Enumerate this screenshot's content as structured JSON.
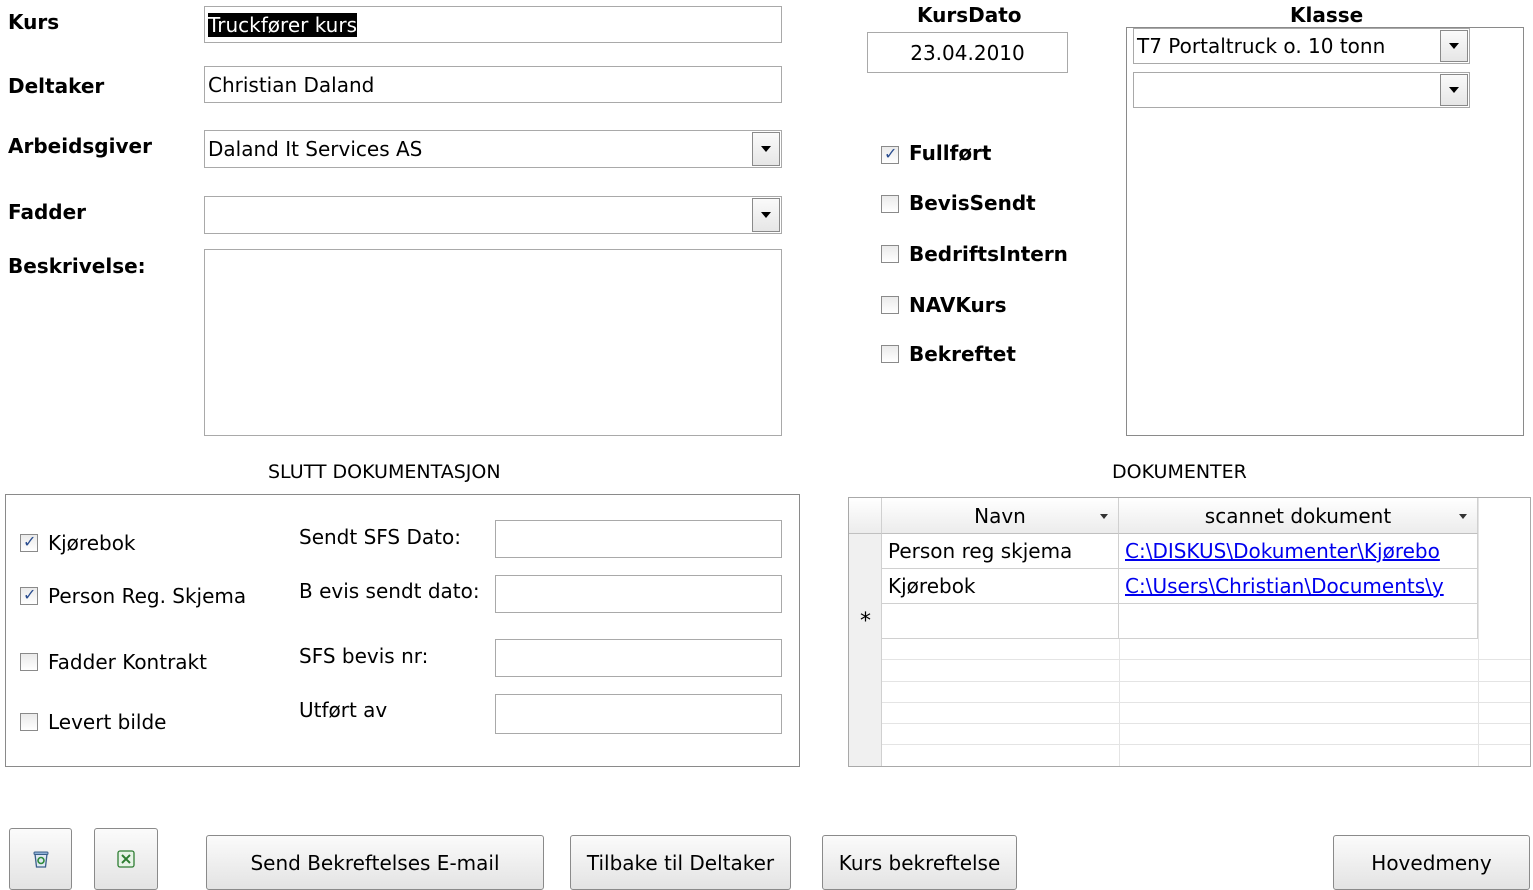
{
  "labels": {
    "kurs": "Kurs",
    "deltaker": "Deltaker",
    "arbeidsgiver": "Arbeidsgiver",
    "fadder": "Fadder",
    "beskrivelse": "Beskrivelse:",
    "kursdato": "KursDato",
    "klasse": "Klasse"
  },
  "values": {
    "kurs": "Truckfører kurs",
    "deltaker": "Christian Daland",
    "arbeidsgiver": "Daland It Services AS",
    "fadder": "",
    "beskrivelse": "",
    "kursdato": "23.04.2010",
    "klasse_1": "T7 Portaltruck o. 10 tonn",
    "klasse_2": ""
  },
  "status_checks": [
    {
      "label": "Fullført",
      "checked": true
    },
    {
      "label": "BevisSendt",
      "checked": false
    },
    {
      "label": "BedriftsIntern",
      "checked": false
    },
    {
      "label": "NAVKurs",
      "checked": false
    },
    {
      "label": "Bekreftet",
      "checked": false
    }
  ],
  "slutt": {
    "title": "SLUTT DOKUMENTASJON",
    "checks": [
      {
        "label": "Kjørebok",
        "checked": true
      },
      {
        "label": "Person Reg. Skjema",
        "checked": true
      },
      {
        "label": "Fadder Kontrakt",
        "checked": false
      },
      {
        "label": "Levert bilde",
        "checked": false
      }
    ],
    "fields": [
      {
        "label": "Sendt SFS Dato:",
        "value": ""
      },
      {
        "label": "B evis sendt dato:",
        "value": ""
      },
      {
        "label": "SFS bevis nr:",
        "value": ""
      },
      {
        "label": "Utført av",
        "value": ""
      }
    ]
  },
  "dokumenter": {
    "title": "DOKUMENTER",
    "columns": [
      "Navn",
      "scannet dokument"
    ],
    "rows": [
      {
        "navn": "Person reg skjema",
        "dokument": "C:\\DISKUS\\Dokumenter\\Kjørebo"
      },
      {
        "navn": "Kjørebok",
        "dokument": "C:\\Users\\Christian\\Documents\\y"
      }
    ],
    "new_row_marker": "*"
  },
  "buttons": {
    "send_email": "Send Bekreftelses E-mail",
    "tilbake": "Tilbake til Deltaker",
    "kurs_bekreftelse": "Kurs bekreftelse",
    "hovedmeny": "Hovedmeny"
  },
  "icons": {
    "delete": "recycle-bin-icon",
    "excel": "excel-icon"
  }
}
